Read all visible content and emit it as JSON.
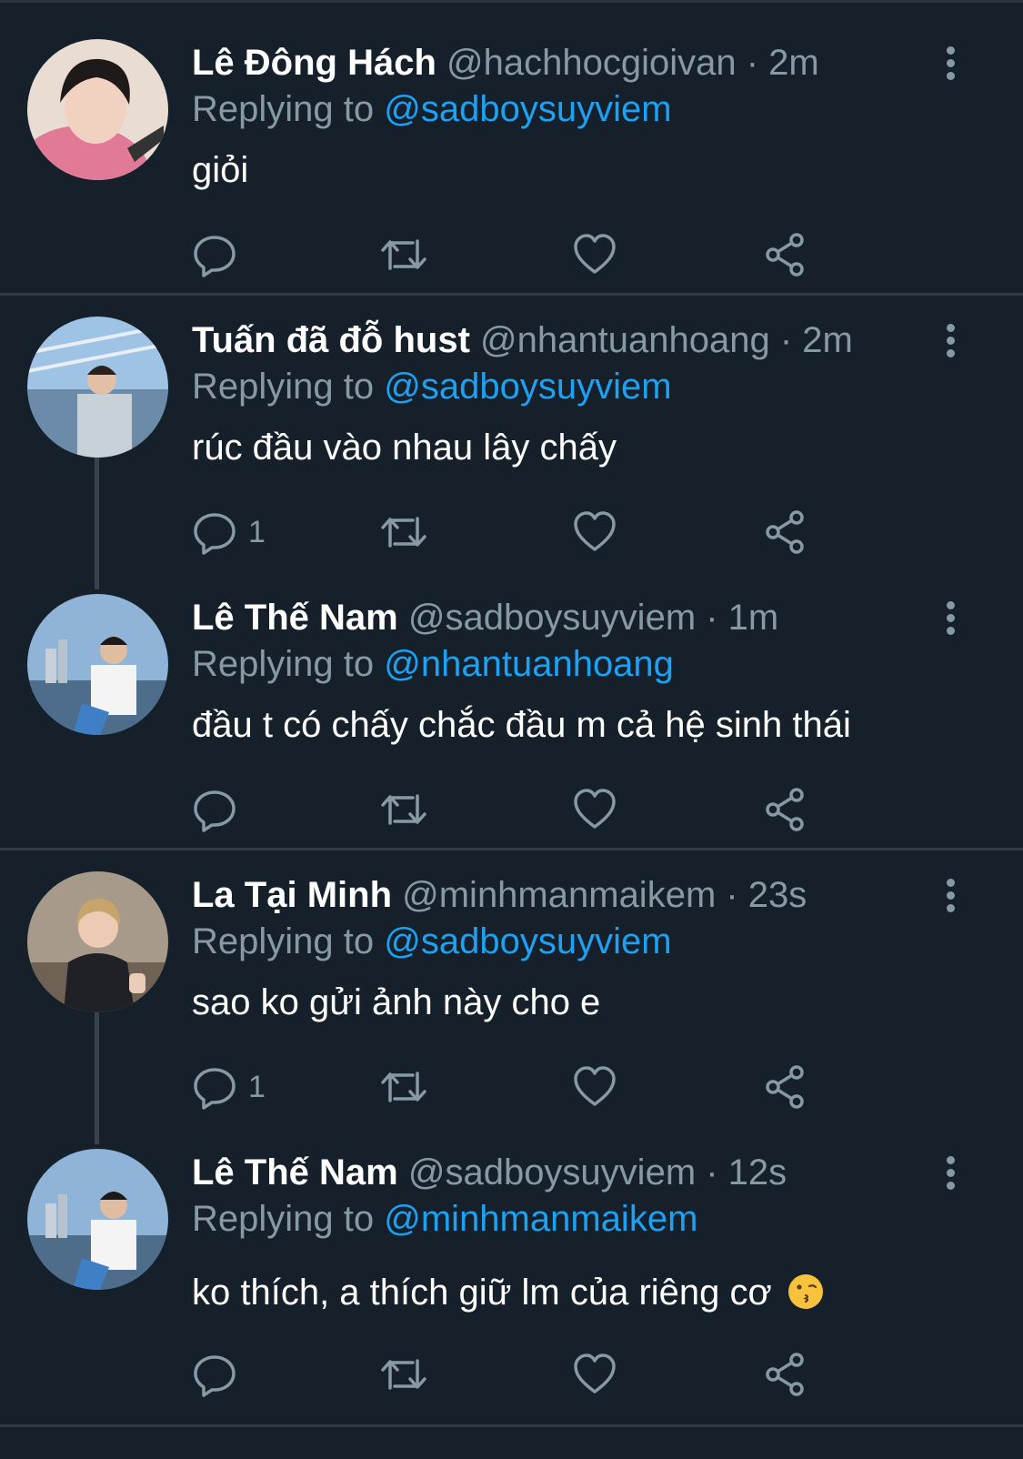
{
  "tweets": [
    {
      "name": "Lê Đông Hách",
      "handle": "@hachhocgioivan · 2m",
      "replying_label": "Replying to",
      "replying_to": "@sadboysuyviem",
      "text": "giỏi",
      "reply_count": ""
    },
    {
      "name": "Tuấn đã đỗ hust",
      "handle": "@nhantuanhoang · 2m",
      "replying_label": "Replying to",
      "replying_to": "@sadboysuyviem",
      "text": "rúc đầu vào nhau lây chấy",
      "reply_count": "1"
    },
    {
      "name": "Lê Thế Nam",
      "handle": "@sadboysuyviem · 1m",
      "replying_label": "Replying to",
      "replying_to": "@nhantuanhoang",
      "text": "đầu t có chấy chắc đầu m cả hệ sinh thái",
      "reply_count": ""
    },
    {
      "name": "La Tại Minh",
      "handle": "@minhmanmaikem · 23s",
      "replying_label": "Replying to",
      "replying_to": "@sadboysuyviem",
      "text": "sao ko gửi ảnh này cho e",
      "reply_count": "1"
    },
    {
      "name": "Lê Thế Nam",
      "handle": "@sadboysuyviem · 12s",
      "replying_label": "Replying to",
      "replying_to": "@minhmanmaikem",
      "text": "ko thích, a thích giữ lm của riêng cơ",
      "emoji": "kissing-face",
      "reply_count": ""
    }
  ],
  "icons": {
    "reply": "reply-icon",
    "retweet": "retweet-icon",
    "like": "heart-icon",
    "share": "share-icon",
    "more": "more-vertical-icon"
  },
  "colors": {
    "background": "#15202b",
    "text": "#ffffff",
    "muted": "#8899a6",
    "accent": "#1da1f2",
    "divider": "#2f3b46"
  }
}
